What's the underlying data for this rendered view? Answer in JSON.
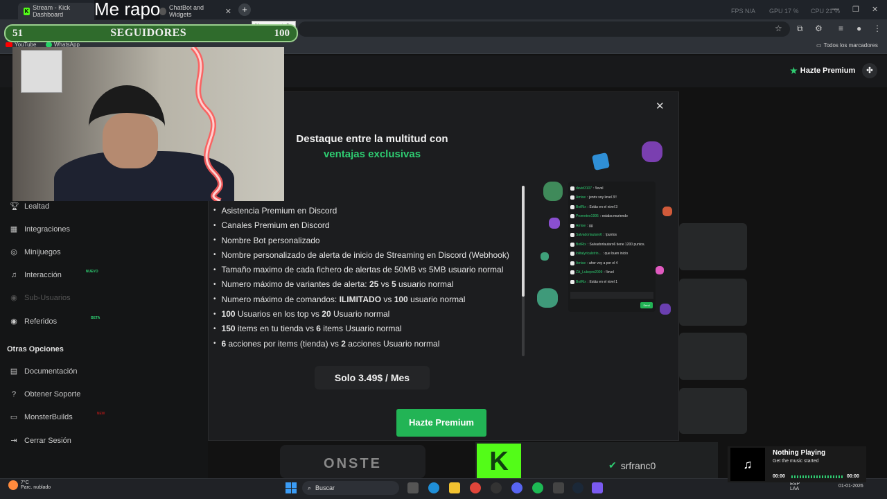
{
  "stream_overlay": {
    "title": "Me rapo",
    "goal": {
      "current": "51",
      "label": "SEGUIDORES",
      "target": "100"
    }
  },
  "browser": {
    "tabs": [
      {
        "label": "Stream - Kick Dashboard"
      },
      {
        "label": "ChatBot and Widgets"
      }
    ],
    "new_tab_tooltip": "Nueva pestaña",
    "perf": {
      "fps": "FPS  N/A",
      "gpu": "GPU  17 %",
      "cpu": "CPU  21 %"
    },
    "bookmarks": [
      {
        "label": "YouTube"
      },
      {
        "label": "WhatsApp"
      }
    ],
    "all_bookmarks": "Todos los marcadores"
  },
  "site": {
    "premium_button": "Hazte Premium",
    "sidebar": {
      "items": [
        {
          "label": "Lealtad",
          "icon": "trophy-icon"
        },
        {
          "label": "Integraciones",
          "icon": "puzzle-icon"
        },
        {
          "label": "Minijuegos",
          "icon": "gamepad-icon"
        },
        {
          "label": "Interacción",
          "icon": "music-note-icon",
          "tag": "NUEVO"
        },
        {
          "label": "Sub-Usuarios",
          "icon": "users-icon"
        },
        {
          "label": "Referidos",
          "icon": "users-icon",
          "tag": "BETA"
        }
      ],
      "section_title": "Otras Opciones",
      "other": [
        {
          "label": "Documentación",
          "icon": "document-icon"
        },
        {
          "label": "Obtener Soporte",
          "icon": "help-icon"
        },
        {
          "label": "MonsterBuilds",
          "icon": "monitor-icon",
          "tag": "NEW"
        },
        {
          "label": "Cerrar Sesión",
          "icon": "logout-icon"
        }
      ]
    },
    "bg_logo_text": "ONSTE",
    "bg_user": "srfranc0"
  },
  "modal": {
    "title_partial": "n",
    "heading": "Destaque entre la multitud con",
    "heading_accent": "ventajas exclusivas",
    "features": [
      {
        "text": "en Discord",
        "html": "en Discord"
      },
      {
        "text": "Asistencia Premium en Discord",
        "html": "Asistencia Premium en Discord"
      },
      {
        "text": "Canales Premium en Discord",
        "html": "Canales Premium en Discord"
      },
      {
        "text": "Nombre Bot personalizado",
        "html": "Nombre Bot personalizado"
      },
      {
        "text": "Nombre personalizado de alerta de inicio de Streaming en Discord (Webhook)",
        "html": "Nombre personalizado de alerta de inicio de Streaming en Discord (Webhook)"
      },
      {
        "text": "Tamaño maximo de cada fichero de alertas de 50MB vs 5MB usuario normal",
        "html": "Tamaño maximo de cada fichero de alertas de 50MB vs 5MB usuario normal"
      },
      {
        "text": "Numero máximo de variantes de alerta: 25 vs 5 usuario normal",
        "html": "Numero máximo de variantes de alerta: <b>25</b> vs <b>5</b> usuario normal"
      },
      {
        "text": "Numero máximo de comandos: ILIMITADO vs 100 usuario normal",
        "html": "Numero máximo de comandos: <b>ILIMITADO</b> vs <b>100</b> usuario normal"
      },
      {
        "text": "100 Usuarios en los top vs 20 Usuario normal",
        "html": "<b>100</b> Usuarios en los top vs <b>20</b> Usuario normal"
      },
      {
        "text": "150 items en tu tienda vs 6 items Usuario normal",
        "html": "<b>150</b> items en tu tienda vs <b>6</b> items Usuario normal"
      },
      {
        "text": "6 acciones por items (tienda) vs 2 acciones Usuario normal",
        "html": "<b>6</b> acciones por items (tienda) vs <b>2</b> acciones Usuario normal"
      }
    ],
    "price": "Solo 3.49$ / Mes",
    "cta": "Hazte Premium",
    "chat_preview": [
      {
        "user": "david3107",
        "msg": ": !level"
      },
      {
        "user": "Arnise",
        "msg": ": jenrix soy level 3!!"
      },
      {
        "user": "BotRix",
        "msg": ": Estás en el nivel 3"
      },
      {
        "user": "Prometeo1995",
        "msg": ": estaba muriendo"
      },
      {
        "user": "Arnise",
        "msg": ": gg"
      },
      {
        "user": "Salvadorlautaro6",
        "msg": ": !puntos"
      },
      {
        "user": "BotRix",
        "msg": ": Salvadorlautaro6 tiene 1200 puntos."
      },
      {
        "user": "lolitalyricalstrin...",
        "msg": ": que buen inicio"
      },
      {
        "user": "Arnise",
        "msg": ": ahor voy a por el 4"
      },
      {
        "user": "ZA_Lukepro2009",
        "msg": ": !level"
      },
      {
        "user": "BotRix",
        "msg": ": Estás en el nivel 1"
      }
    ],
    "chat_send": "Send"
  },
  "music": {
    "title": "Nothing Playing",
    "subtitle": "Get the music started",
    "time_start": "00:00",
    "time_end": "00:00"
  },
  "taskbar": {
    "weather_temp": "7°C",
    "weather_desc": "Parc. nublado",
    "search_placeholder": "Buscar",
    "lang": "ESP",
    "region": "LAA",
    "date": "01-01-2026"
  }
}
